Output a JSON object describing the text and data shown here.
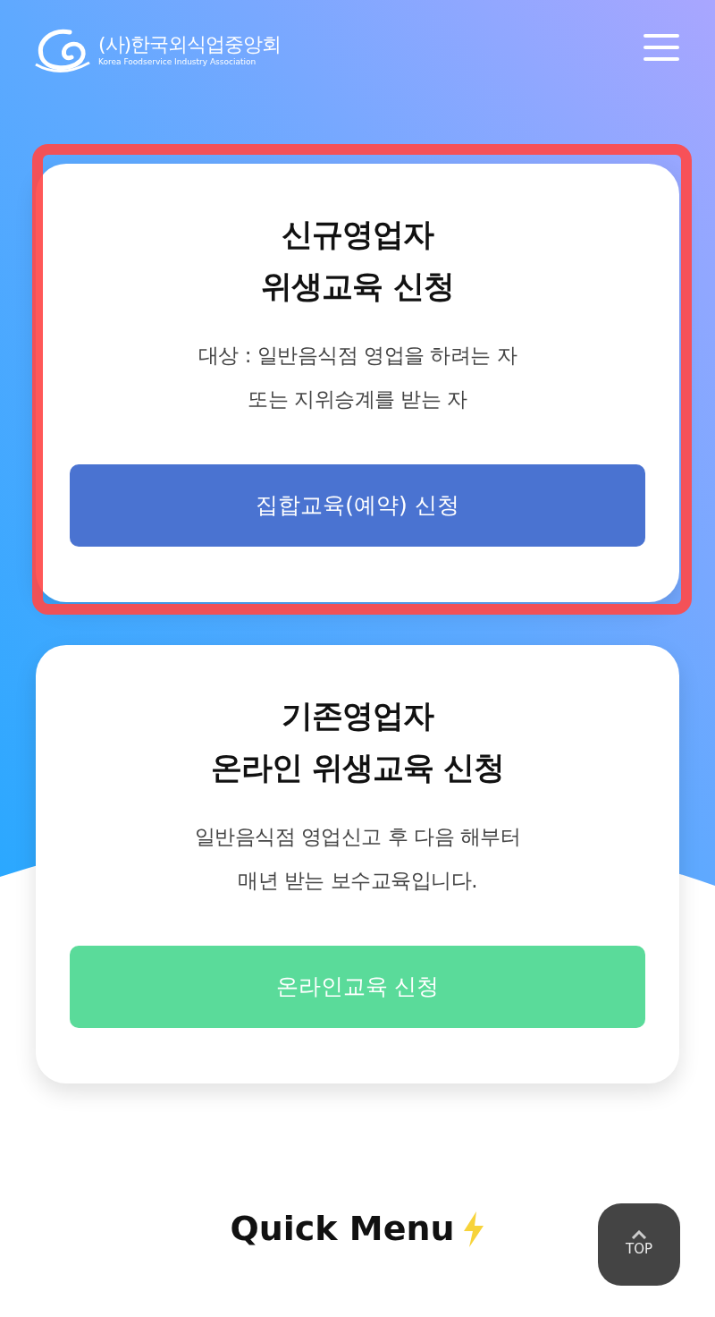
{
  "header": {
    "logo_title": "(사)한국외식업중앙회",
    "logo_subtitle": "Korea Foodservice Industry Association"
  },
  "cards": [
    {
      "title": "신규영업자\n위생교육 신청",
      "description": "대상 : 일반음식점 영업을 하려는 자\n또는 지위승계를 받는 자",
      "button": "집합교육(예약) 신청",
      "color": "#4a73d1",
      "highlighted": true
    },
    {
      "title": "기존영업자\n온라인 위생교육 신청",
      "description": "일반음식점 영업신고 후 다음 해부터\n매년 받는 보수교육입니다.",
      "button": "온라인교육 신청",
      "color": "#5adb9a",
      "highlighted": false
    }
  ],
  "quick_menu": {
    "title": "Quick Menu"
  },
  "top_button": {
    "label": "TOP"
  }
}
